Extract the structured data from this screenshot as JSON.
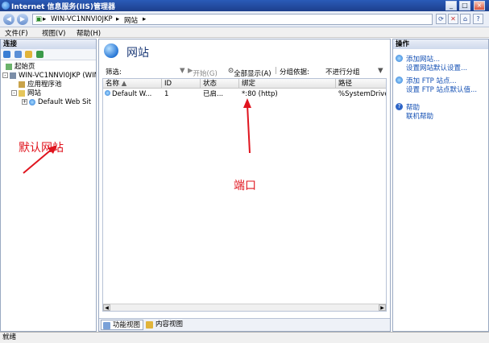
{
  "window": {
    "title": "Internet 信息服务(IIS)管理器",
    "controls": [
      "_",
      "□",
      "×"
    ]
  },
  "address": {
    "segments": [
      "WIN-VC1NNVI0JKP",
      "▸",
      "网站",
      "▸"
    ]
  },
  "menu": [
    "文件(F)",
    "视图(V)",
    "帮助(H)"
  ],
  "connections": {
    "header": "连接",
    "tree": [
      {
        "label": "起始页",
        "level": 0,
        "icon": "start-page-icon"
      },
      {
        "label": "WIN-VC1NNVI0JKP (WIN",
        "level": 0,
        "icon": "server-icon",
        "expander": "-"
      },
      {
        "label": "应用程序池",
        "level": 1,
        "icon": "app-pool-icon"
      },
      {
        "label": "网站",
        "level": 1,
        "icon": "sites-folder-icon",
        "expander": "-"
      },
      {
        "label": "Default Web Sit",
        "level": 2,
        "icon": "globe-icon",
        "expander": "+"
      }
    ]
  },
  "main": {
    "title": "网站",
    "filter": {
      "label": "筛选:",
      "start_button": "开始(G)",
      "show_all_button": "全部显示(A)",
      "group_label": "分组依据:",
      "group_value": "不进行分组"
    },
    "columns": [
      "名称",
      "ID",
      "状态",
      "绑定",
      "路径"
    ],
    "rows": [
      {
        "name": "Default W...",
        "id": "1",
        "status": "已启...",
        "binding": "*:80 (http)",
        "path": "%SystemDrive"
      }
    ],
    "view_tabs": [
      "功能视图",
      "内容视图"
    ]
  },
  "actions": {
    "header": "操作",
    "items": [
      {
        "label": "添加网站...",
        "icon": "add-icon"
      },
      {
        "label": "设置网站默认设置...",
        "icon": ""
      },
      {
        "label": "添加 FTP 站点...",
        "icon": "add-icon"
      },
      {
        "label": "设置 FTP 站点默认值...",
        "icon": ""
      },
      {
        "label": "帮助",
        "icon": "help-icon"
      },
      {
        "label": "联机帮助",
        "icon": ""
      }
    ]
  },
  "status": "就绪",
  "annotations": {
    "default_site": "默认网站",
    "port": "端口"
  },
  "colors": {
    "annotation": "#e0141e",
    "link": "#1450b4",
    "titlebar": "#2a5bb8"
  }
}
